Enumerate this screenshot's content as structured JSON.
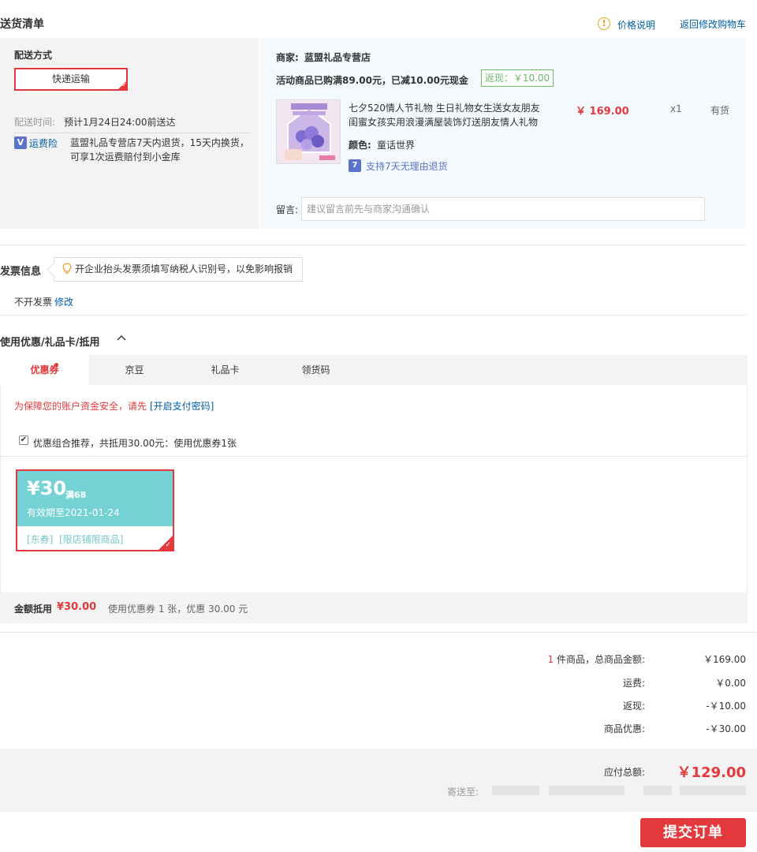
{
  "header": {
    "title": "送货清单",
    "price_info": "价格说明",
    "back_to_cart": "返回修改购物车"
  },
  "shipping": {
    "method_label": "配送方式",
    "method_value": "快递运输",
    "time_label": "配送时间:",
    "time_value": "预计1月24日24:00前送达",
    "insurance_label": "运费险",
    "insurance_text_1": "蓝盟礼品专营店7天内退货，15天内换货，",
    "insurance_text_2": "可享1次运费赔付到小金库"
  },
  "merchant": {
    "label": "商家:",
    "name": "蓝盟礼品专营店",
    "promo_text": "活动商品已购满89.00元，已减10.00元现金",
    "cashback_badge": "返现：￥10.00"
  },
  "product": {
    "title_line1": "七夕520情人节礼物 生日礼物女生送女友朋友",
    "title_line2": "闺蜜女孩实用浪漫满屋装饰灯送朋友情人礼物",
    "price": "￥ 169.00",
    "quantity": "x1",
    "stock": "有货",
    "color_label": "颜色:",
    "color_value": "童话世界",
    "return_icon_text": "7",
    "return_policy": "支持7天无理由退货"
  },
  "message": {
    "label": "留言:",
    "placeholder": "建议留言前先与商家沟通确认"
  },
  "invoice": {
    "title": "发票信息",
    "tip": "开企业抬头发票须填写纳税人识别号，以免影响报销",
    "status": "不开发票",
    "edit_link": "修改"
  },
  "discounts": {
    "title": "使用优惠/礼品卡/抵用",
    "tabs": [
      "优惠券",
      "京豆",
      "礼品卡",
      "领货码"
    ],
    "security_notice": "为保障您的账户资金安全，请先",
    "security_link": "[开启支付密码]",
    "combo_text": "优惠组合推荐，共抵用30.00元：使用优惠券1张",
    "coupon": {
      "amount": "¥30",
      "condition": "满68",
      "validity": "有效期至2021-01-24",
      "tag1": "[东券]",
      "tag2": "[限店铺限商品]"
    },
    "summary_label": "金额抵用",
    "summary_amount": "¥30.00",
    "summary_text": "使用优惠券 1 张，优惠 30.00 元"
  },
  "totals": {
    "item_count": "1",
    "items_label": "件商品，总商品金额:",
    "items_value": "￥169.00",
    "shipping_label": "运费:",
    "shipping_value": "￥0.00",
    "cashback_label": "返现:",
    "cashback_value": "-￥10.00",
    "discount_label": "商品优惠:",
    "discount_value": "-￥30.00",
    "payable_label": "应付总额:",
    "payable_value": "￥129.00",
    "ship_to_label": "寄送至:"
  },
  "submit_label": "提交订单",
  "colors": {
    "accent_red": "#e4393c",
    "link_blue": "#005ea7",
    "coupon_teal": "#74d2d4",
    "cashback_green": "#6fb86c"
  }
}
